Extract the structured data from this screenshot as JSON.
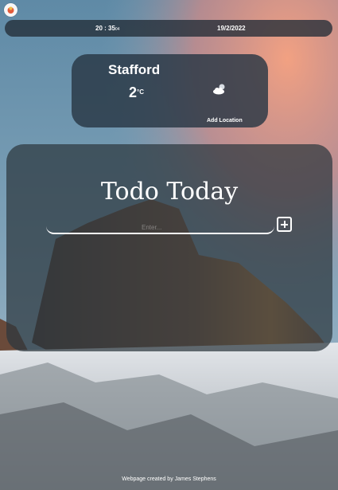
{
  "header": {
    "time_main": "20 : 35",
    "time_seconds": "04",
    "date": "19/2/2022"
  },
  "weather": {
    "city": "Stafford",
    "temperature": "2",
    "unit": "°C",
    "icon": "cloud-moon-icon",
    "add_location_label": "Add Location"
  },
  "todo": {
    "title": "Todo Today",
    "input_placeholder": "Enter...",
    "add_icon": "plus-square-icon"
  },
  "footer": {
    "credit": "Webpage created by James Stephens"
  }
}
